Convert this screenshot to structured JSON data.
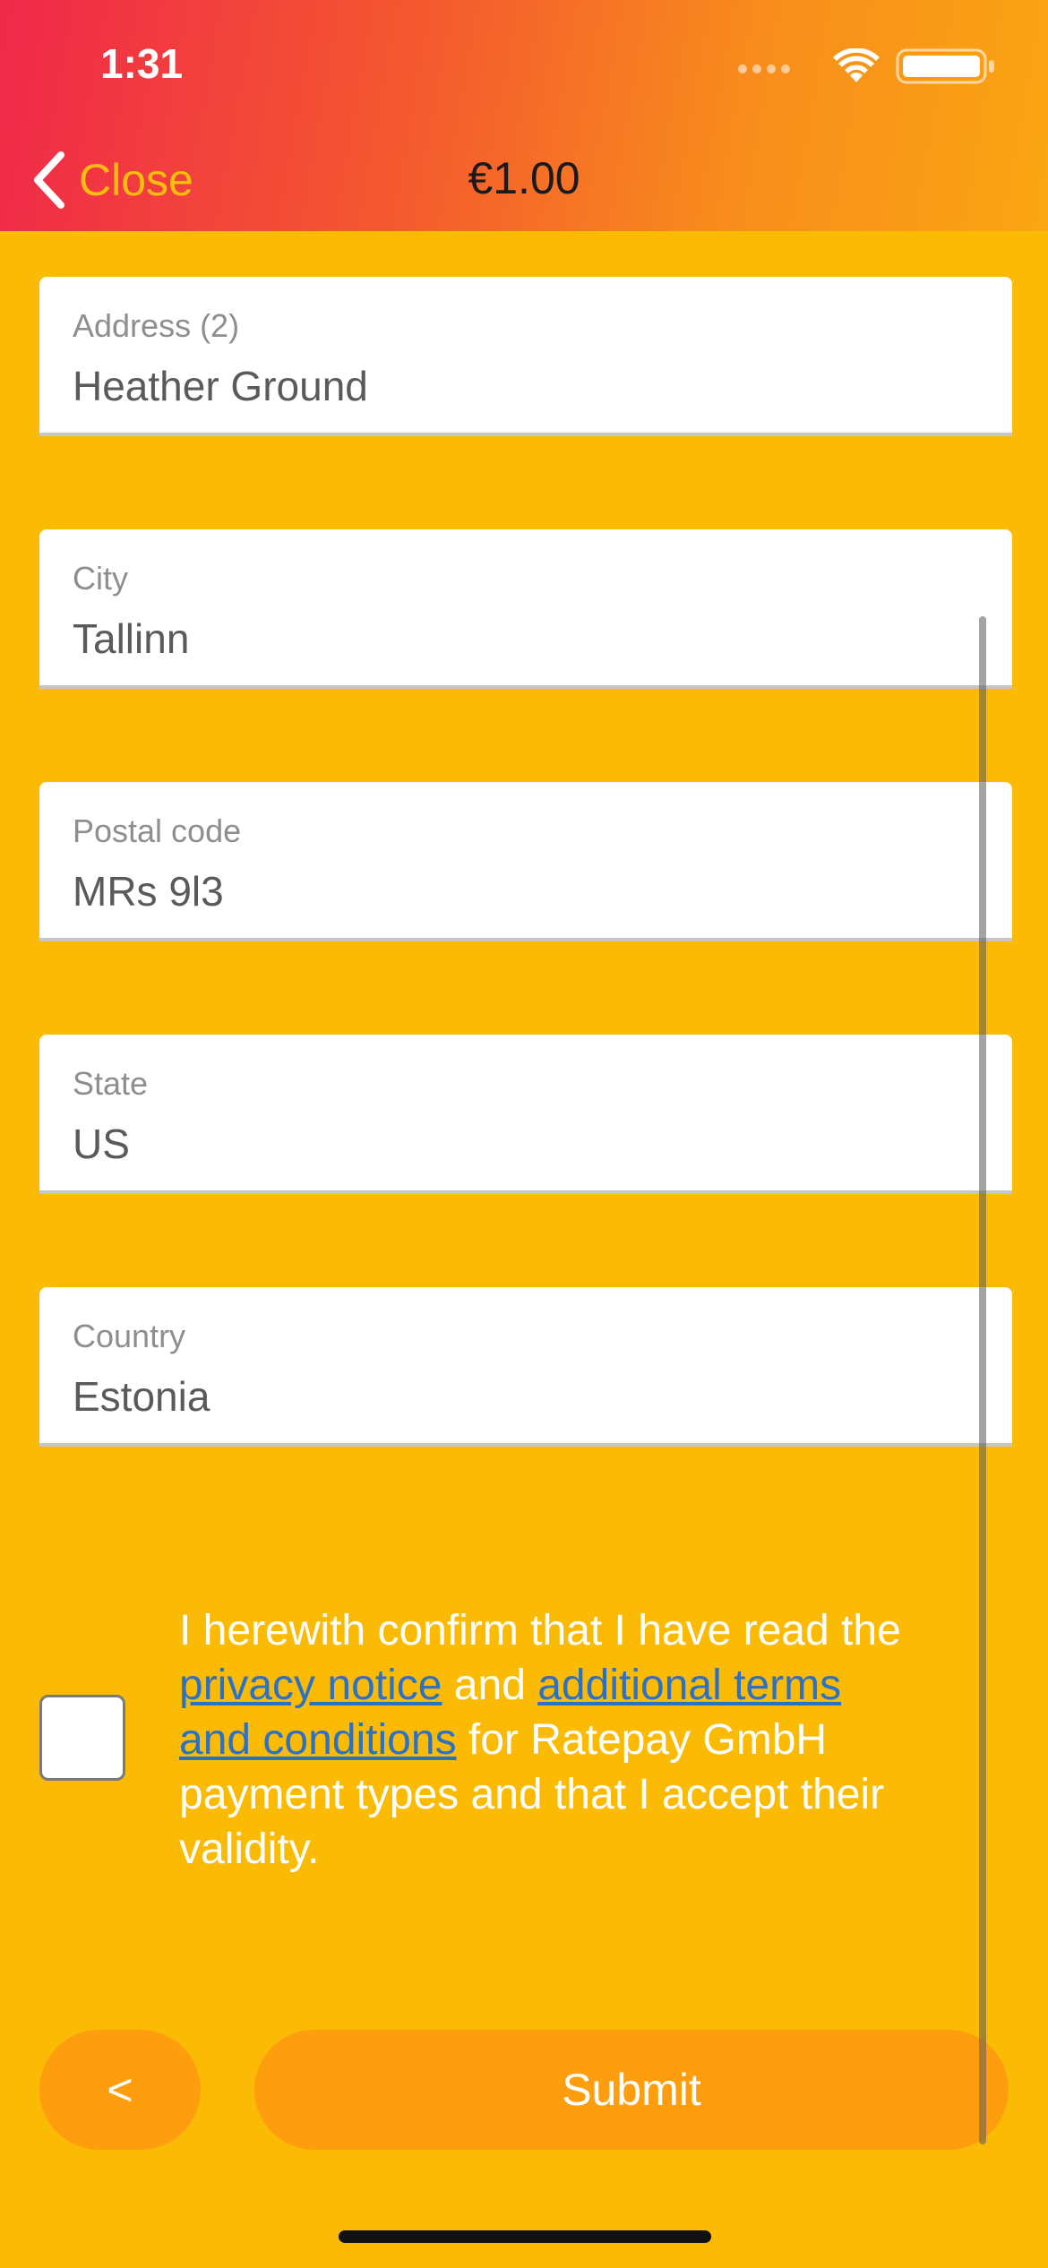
{
  "status_bar": {
    "time": "1:31"
  },
  "nav": {
    "close_label": "Close",
    "title": "€1.00"
  },
  "fields": [
    {
      "label": "Address (2)",
      "value": "Heather Ground"
    },
    {
      "label": "City",
      "value": "Tallinn"
    },
    {
      "label": "Postal code",
      "value": "MRs 9l3"
    },
    {
      "label": "State",
      "value": "US"
    },
    {
      "label": "Country",
      "value": "Estonia"
    }
  ],
  "consent": {
    "checked": false,
    "text_1": "I herewith confirm that I have read the ",
    "link_privacy": "privacy notice",
    "text_2": " and ",
    "link_terms": "additional terms and conditions",
    "text_3": " for Ratepay GmbH payment types and that I accept their validity."
  },
  "actions": {
    "back_label": "<",
    "submit_label": "Submit"
  },
  "colors": {
    "background": "#FBBB05",
    "button": "#FE9E0E",
    "link": "#2B72C6",
    "header_gradient_start": "#F0284A",
    "header_gradient_end": "#FAA612"
  },
  "icons": [
    "signal-dots-icon",
    "wifi-icon",
    "battery-icon",
    "chevron-left-icon"
  ]
}
